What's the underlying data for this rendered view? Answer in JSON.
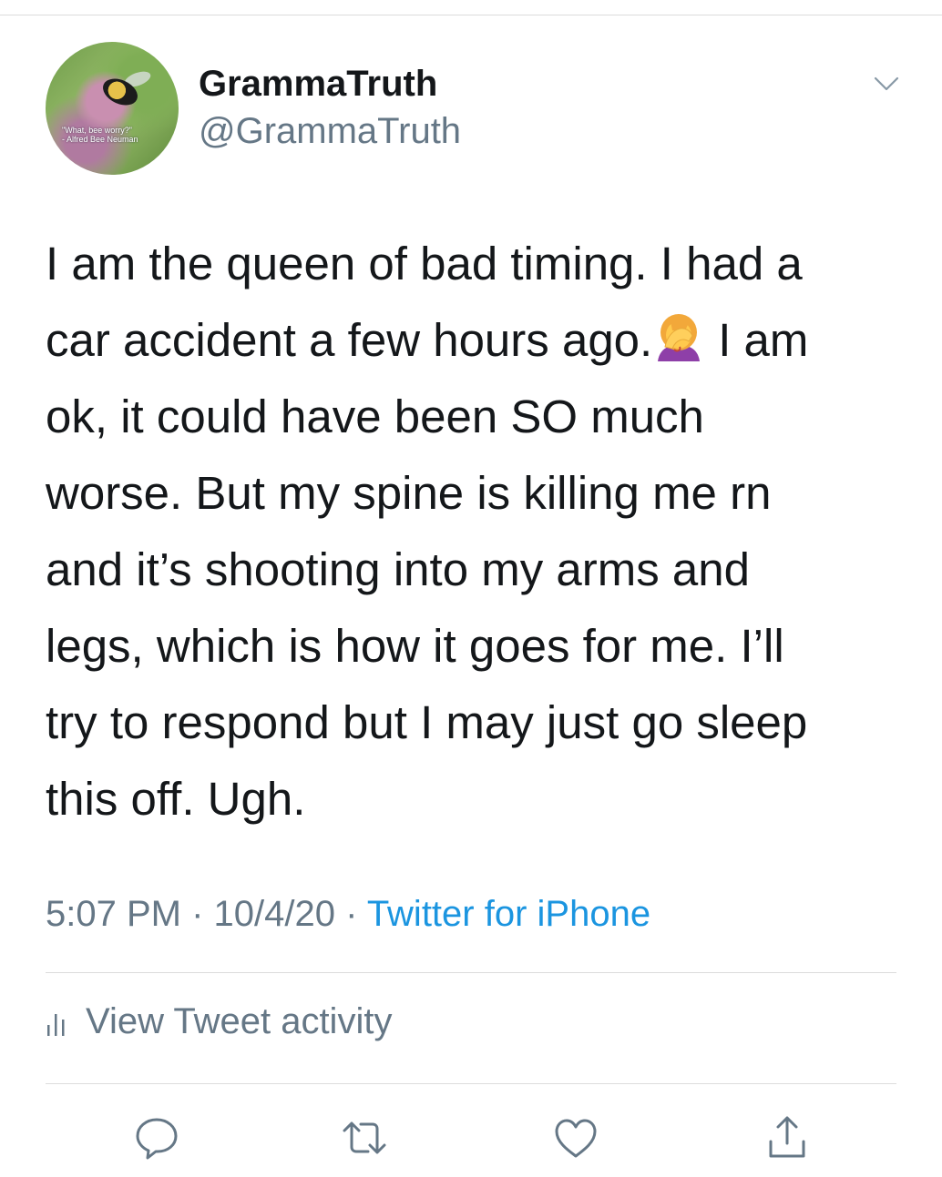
{
  "author": {
    "display_name": "GrammaTruth",
    "handle": "@GrammaTruth",
    "avatar_caption_line1": "\"What, bee worry?\"",
    "avatar_caption_line2": "- Alfred Bee Neuman"
  },
  "tweet": {
    "lines": [
      "I am the queen of bad timing. I had a",
      "car accident a few hours ago.",
      "I am",
      "ok, it could have been SO much",
      "worse. But my spine is killing me rn",
      "and it’s shooting into my arms and",
      "legs, which is how it goes for me. I’ll",
      "try to respond but I may just go sleep",
      "this off. Ugh."
    ],
    "emoji": "face-palm-woman"
  },
  "meta": {
    "time": "5:07 PM",
    "separator": " · ",
    "date": "10/4/20",
    "source": "Twitter for iPhone"
  },
  "activity": {
    "label": "View Tweet activity"
  },
  "actions": [
    "reply-icon",
    "retweet-icon",
    "like-icon",
    "share-icon"
  ],
  "colors": {
    "text": "#14171a",
    "secondary": "#657786",
    "link": "#1b95e0",
    "divider": "#dcdcdc"
  }
}
